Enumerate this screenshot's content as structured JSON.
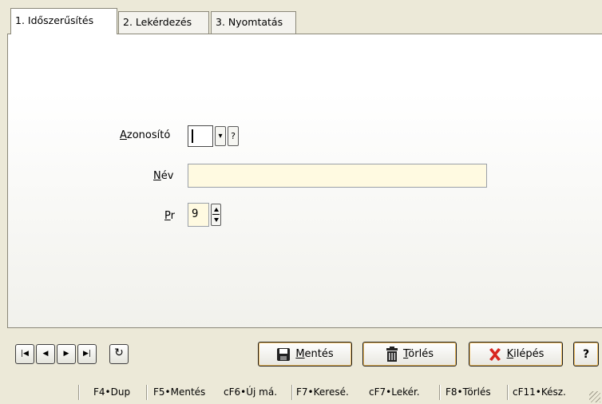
{
  "tabs": [
    {
      "label": "1. Időszerűsítés"
    },
    {
      "label": "2. Lekérdezés"
    },
    {
      "label": "3. Nyomtatás"
    }
  ],
  "form": {
    "azonosito": {
      "label_first": "A",
      "label_rest": "zonosító",
      "value": "",
      "dropdown_glyph": "▾",
      "help_glyph": "?"
    },
    "nev": {
      "label_first": "N",
      "label_rest": "év",
      "value": ""
    },
    "pr": {
      "label_first": "P",
      "label_rest": "r",
      "value": "9"
    }
  },
  "buttons": {
    "save": {
      "first": "M",
      "rest": "entés",
      "icon": "floppy-disk-icon"
    },
    "delete": {
      "first": "T",
      "rest": "örlés",
      "icon": "trash-can-icon"
    },
    "exit": {
      "first": "K",
      "rest": "ilépés",
      "icon": "red-x-icon"
    },
    "help": {
      "label": "?"
    }
  },
  "nav": {
    "first": "|◀",
    "prev": "◀",
    "next": "▶",
    "last": "▶|",
    "refresh": "↻"
  },
  "statusbar": {
    "items": [
      "F4•Dup",
      "F5•Mentés",
      "cF6•Új má.",
      "F7•Keresé.",
      "cF7•Lekér.",
      "F8•Törlés",
      "cF11•Kész."
    ]
  },
  "colors": {
    "input_bg": "#fffae1",
    "accent_border": "#f2c062",
    "exit_icon": "#d8261f"
  }
}
